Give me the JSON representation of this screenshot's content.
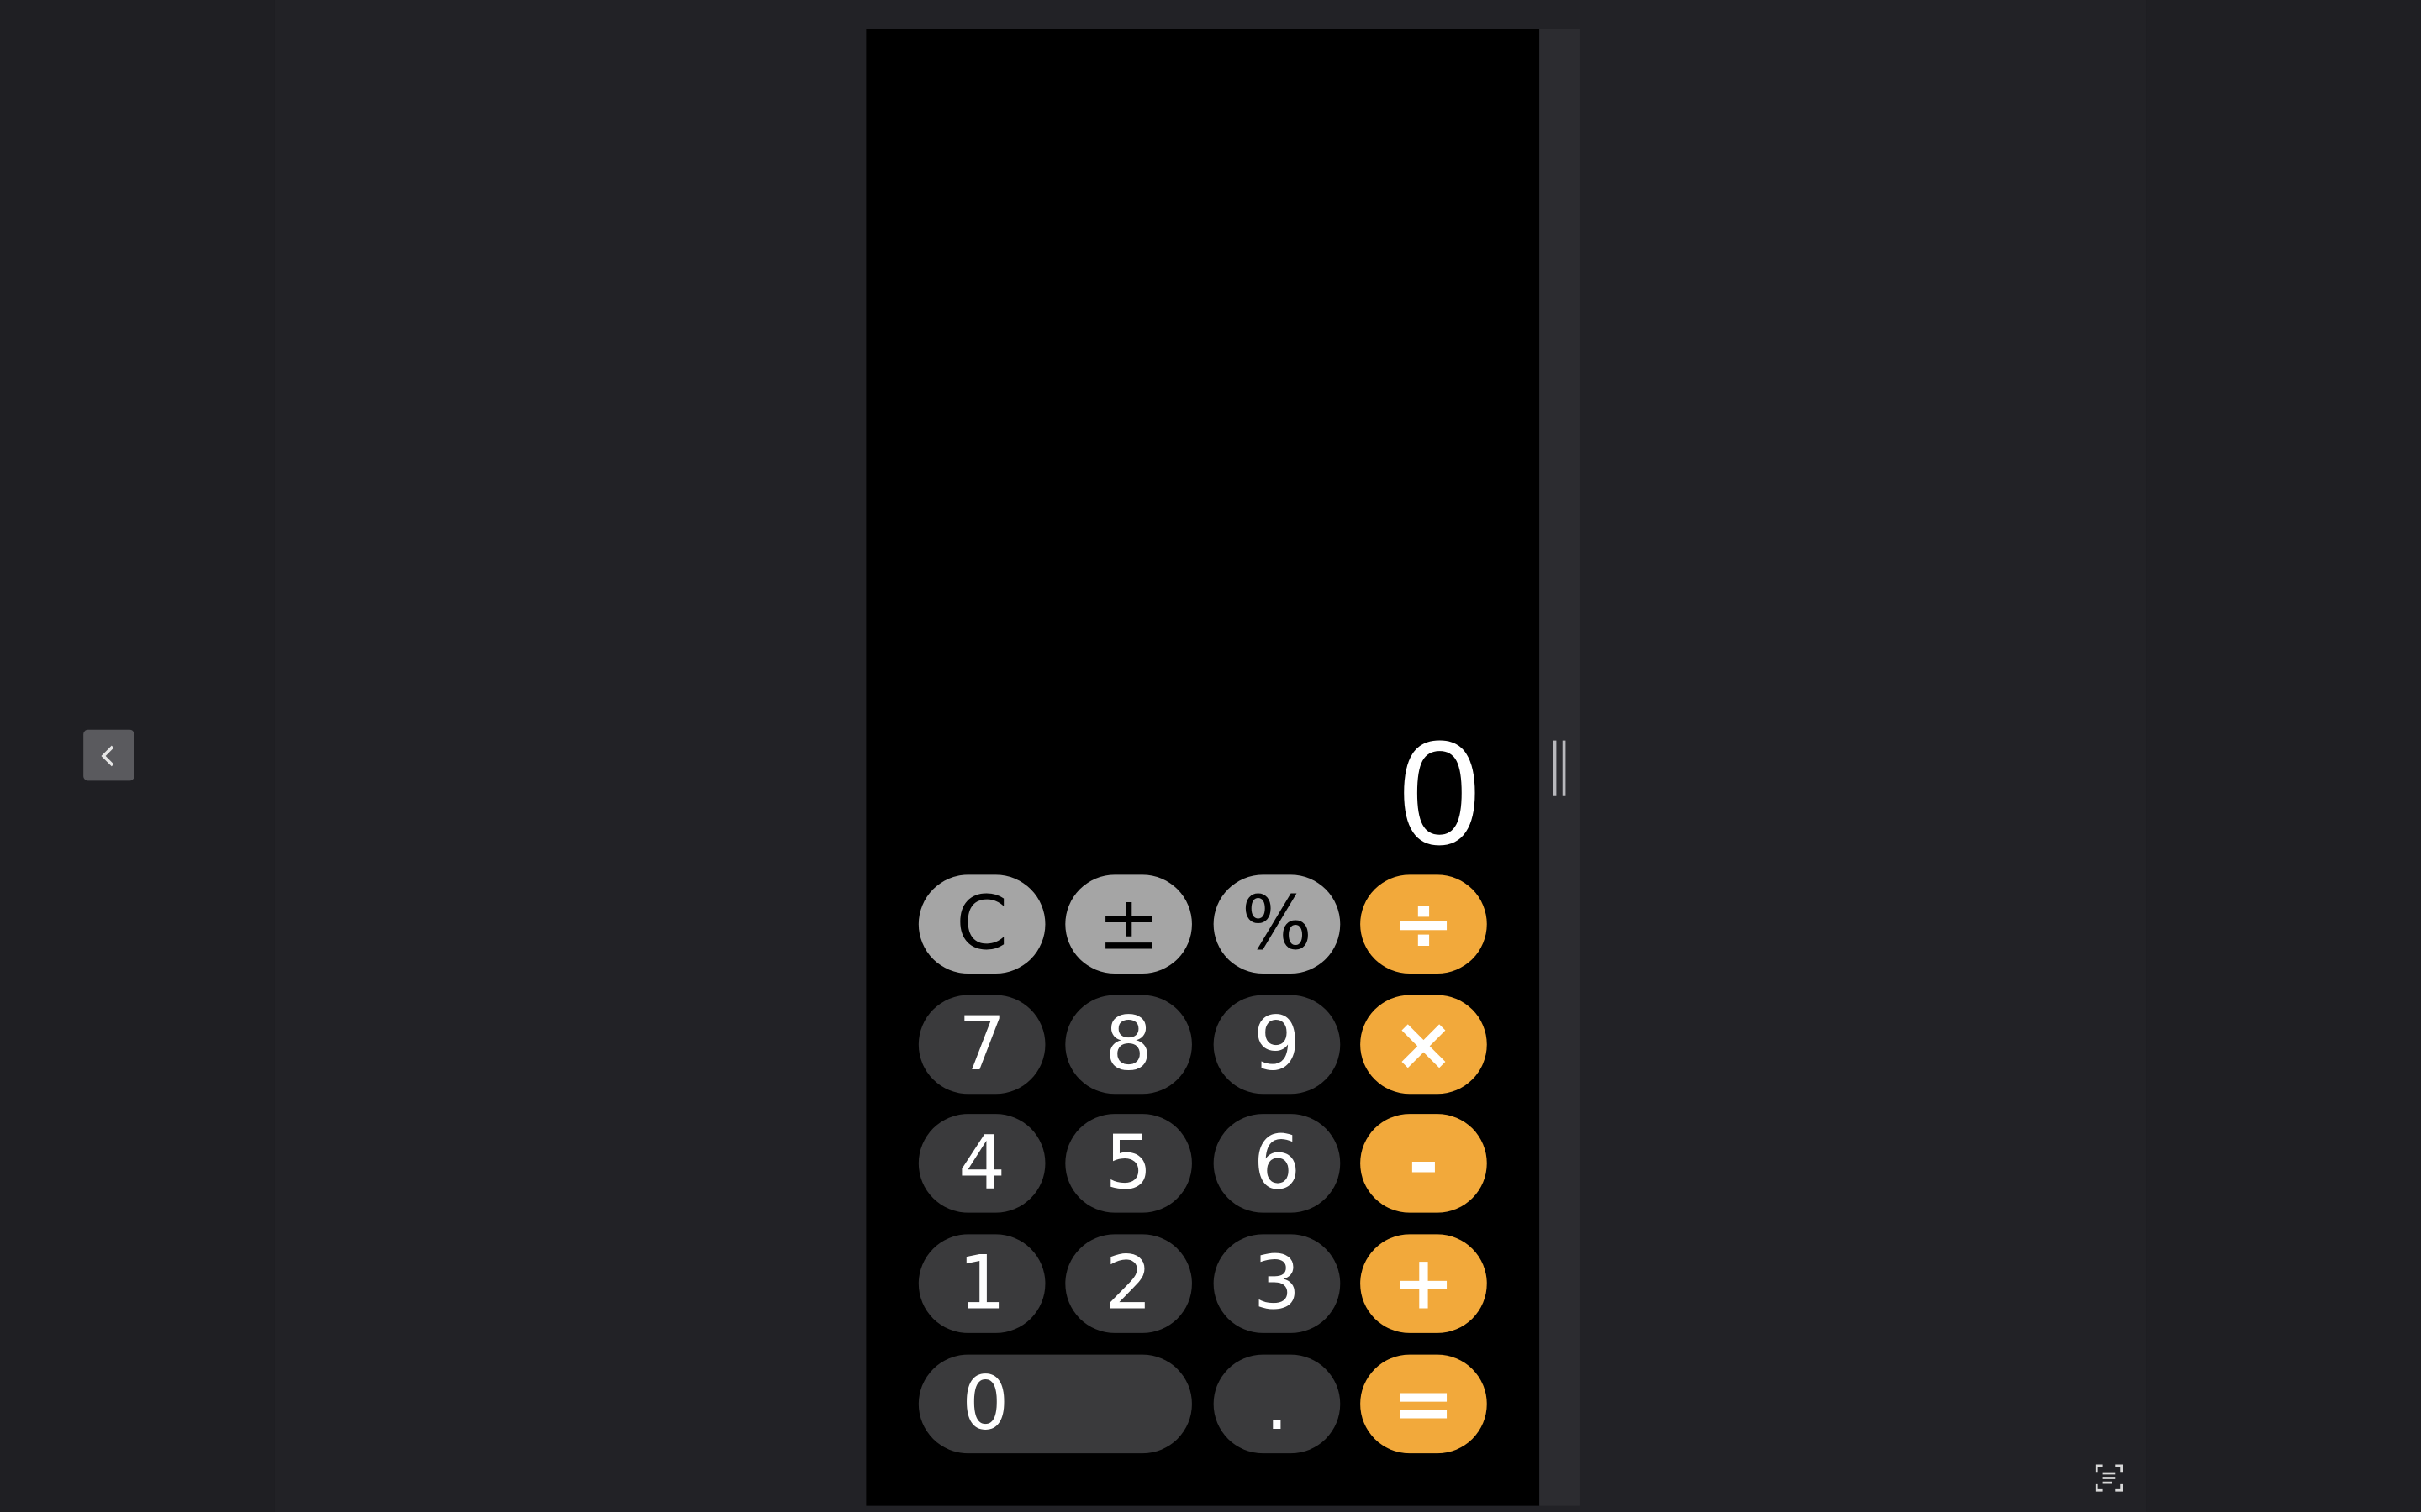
{
  "navigation": {
    "back_icon": "chevron-left-icon"
  },
  "calculator": {
    "display": "0",
    "rows": [
      [
        {
          "label": "C",
          "kind": "fn",
          "name": "clear-button"
        },
        {
          "label": "±",
          "kind": "fn",
          "name": "plus-minus-button"
        },
        {
          "label": "%",
          "kind": "fn",
          "name": "percent-button"
        },
        {
          "label": "÷",
          "kind": "op",
          "name": "divide-button"
        }
      ],
      [
        {
          "label": "7",
          "kind": "num",
          "name": "digit-7-button"
        },
        {
          "label": "8",
          "kind": "num",
          "name": "digit-8-button"
        },
        {
          "label": "9",
          "kind": "num",
          "name": "digit-9-button"
        },
        {
          "label": "×",
          "kind": "op",
          "name": "multiply-button"
        }
      ],
      [
        {
          "label": "4",
          "kind": "num",
          "name": "digit-4-button"
        },
        {
          "label": "5",
          "kind": "num",
          "name": "digit-5-button"
        },
        {
          "label": "6",
          "kind": "num",
          "name": "digit-6-button"
        },
        {
          "label": "-",
          "kind": "op",
          "name": "subtract-button"
        }
      ],
      [
        {
          "label": "1",
          "kind": "num",
          "name": "digit-1-button"
        },
        {
          "label": "2",
          "kind": "num",
          "name": "digit-2-button"
        },
        {
          "label": "3",
          "kind": "num",
          "name": "digit-3-button"
        },
        {
          "label": "+",
          "kind": "op",
          "name": "add-button"
        }
      ],
      [
        {
          "label": "0",
          "kind": "num",
          "name": "digit-0-button"
        },
        {
          "label": ".",
          "kind": "num",
          "name": "decimal-button"
        },
        {
          "label": "=",
          "kind": "op",
          "name": "equals-button"
        }
      ]
    ]
  },
  "colors": {
    "operator": "#f2a93b",
    "function": "#a5a5a5",
    "digit": "#3a3a3c",
    "background": "#000000"
  },
  "toolbar": {
    "scan_icon": "scan-text-icon"
  }
}
